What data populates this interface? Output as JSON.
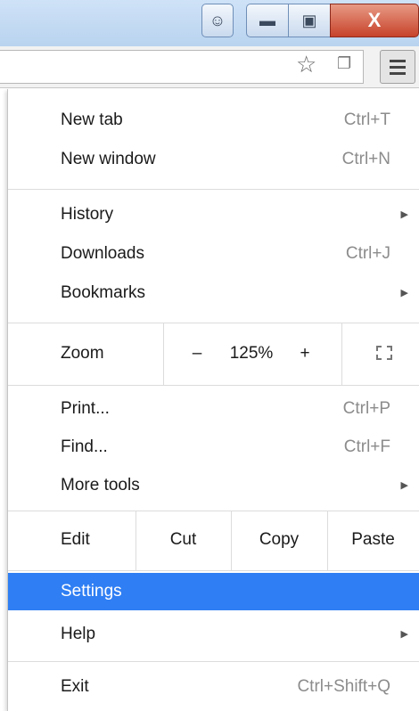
{
  "window": {
    "controls": [
      "profile",
      "minimize",
      "maximize",
      "close"
    ],
    "close_glyph": "X"
  },
  "toolbar": {
    "bookmark_icon": "star-icon",
    "extension_icon": "extension-icon",
    "menu_icon": "hamburger-menu-icon"
  },
  "menu": {
    "new_tab": {
      "label": "New tab",
      "shortcut": "Ctrl+T"
    },
    "new_window": {
      "label": "New window",
      "shortcut": "Ctrl+N"
    },
    "history": {
      "label": "History"
    },
    "downloads": {
      "label": "Downloads",
      "shortcut": "Ctrl+J"
    },
    "bookmarks": {
      "label": "Bookmarks"
    },
    "zoom": {
      "label": "Zoom",
      "minus": "–",
      "value": "125%",
      "plus": "+"
    },
    "print": {
      "label": "Print...",
      "shortcut": "Ctrl+P"
    },
    "find": {
      "label": "Find...",
      "shortcut": "Ctrl+F"
    },
    "more_tools": {
      "label": "More tools"
    },
    "edit": {
      "label": "Edit",
      "cut": "Cut",
      "copy": "Copy",
      "paste": "Paste"
    },
    "settings": {
      "label": "Settings"
    },
    "help": {
      "label": "Help"
    },
    "exit": {
      "label": "Exit",
      "shortcut": "Ctrl+Shift+Q"
    },
    "highlight_color": "#2f7ef3"
  }
}
